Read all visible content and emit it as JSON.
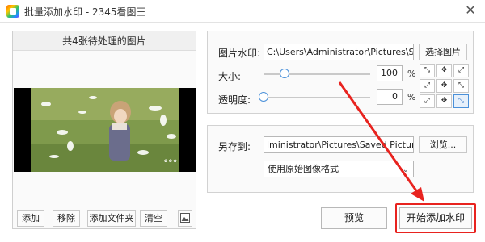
{
  "window": {
    "title": "批量添加水印 - 2345看图王",
    "close_glyph": "✕"
  },
  "left": {
    "header": "共4张待处理的图片",
    "buttons": {
      "add": "添加",
      "remove": "移除",
      "add_folder": "添加文件夹",
      "clear": "清空"
    }
  },
  "watermark": {
    "image_label": "图片水印:",
    "image_path": "C:\\Users\\Administrator\\Pictures\\Saved",
    "choose_label": "选择图片",
    "size_label": "大小:",
    "size_value": "100",
    "opacity_label": "透明度:",
    "opacity_value": "0",
    "percent": "%",
    "size_level": 0.2,
    "opacity_level": 0.0,
    "position_selected": "bottom-right"
  },
  "save": {
    "label": "另存到:",
    "path": "lministrator\\Pictures\\Saved Pictures\\",
    "browse_label": "浏览...",
    "format_value": "使用原始图像格式",
    "format_arrow": "⌄"
  },
  "actions": {
    "preview": "预览",
    "start": "开始添加水印"
  },
  "colors": {
    "accent": "#4a90d9",
    "highlight": "#e8231f"
  }
}
